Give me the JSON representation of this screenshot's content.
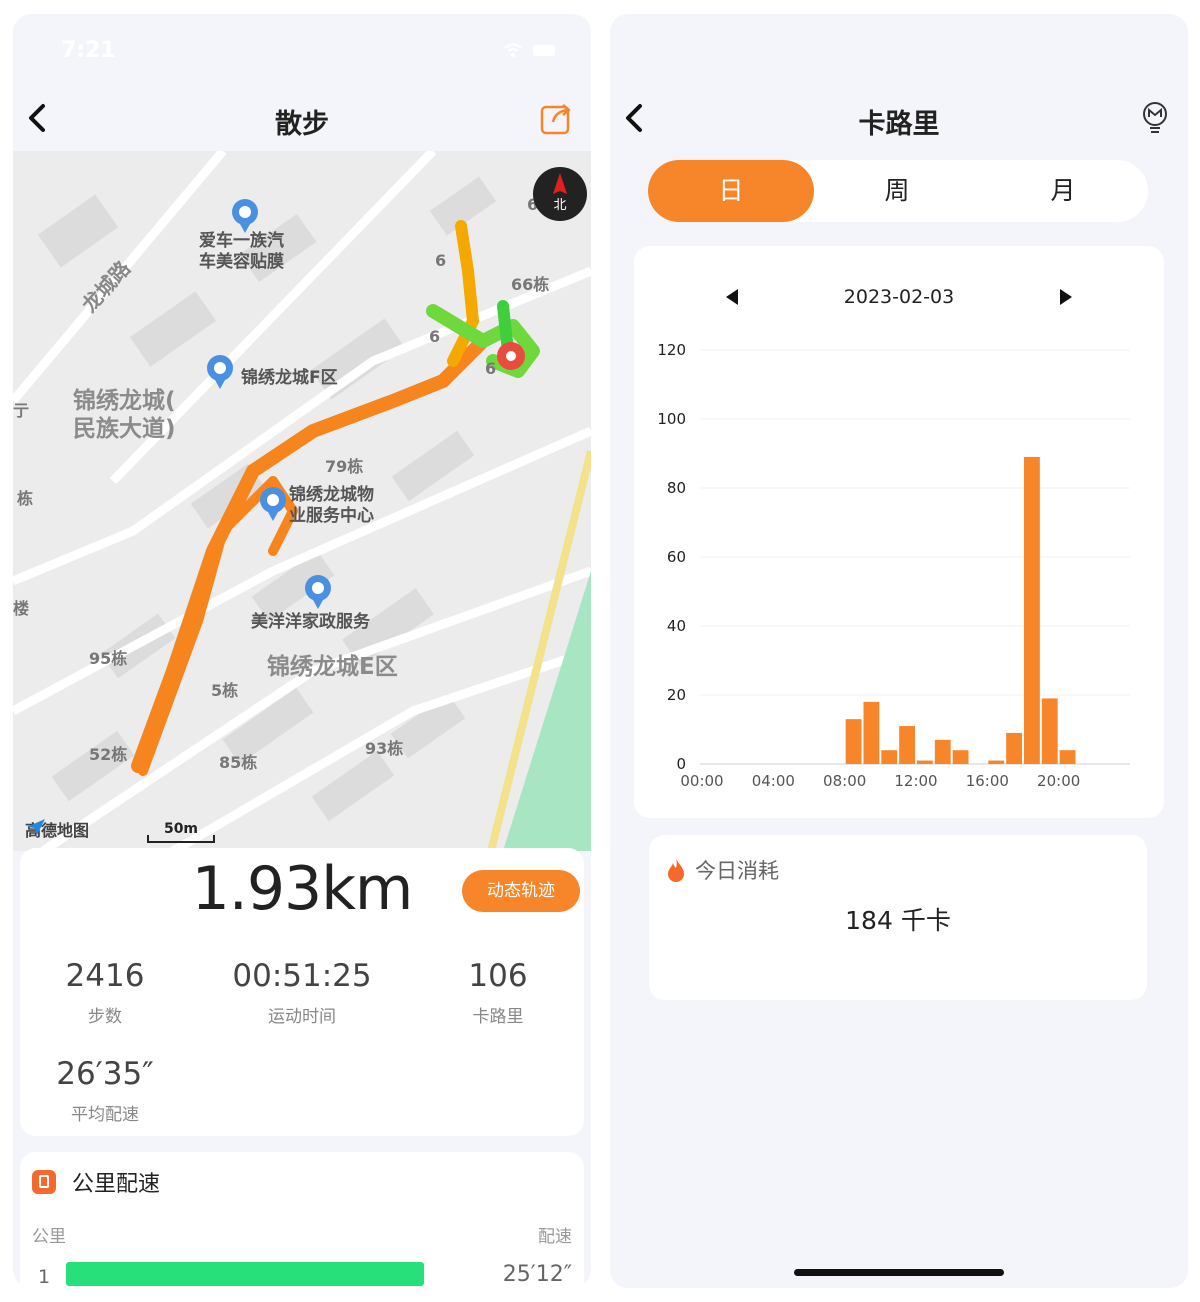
{
  "left": {
    "status_time": "7:21",
    "title": "散步",
    "map": {
      "labels": [
        "爱车一族汽\n车美容贴膜",
        "锦绣龙城F区",
        "锦绣龙城(\n民族大道)",
        "锦绣龙城物\n业服务中心",
        "美洋洋家政服务",
        "锦绣龙城E区",
        "龙城路"
      ],
      "numbers": [
        "66栋",
        "79栋",
        "95栋",
        "5栋",
        "52栋",
        "85栋",
        "93栋",
        "6",
        "6",
        "6",
        "6",
        "栋",
        "楼",
        "亍"
      ],
      "compass": "北",
      "brand": "高德地图",
      "scale": "50m"
    },
    "distance": "1.93km",
    "dynamic_button": "动态轨迹",
    "stats": [
      {
        "value": "2416",
        "label": "步数"
      },
      {
        "value": "00:51:25",
        "label": "运动时间"
      },
      {
        "value": "106",
        "label": "卡路里"
      },
      {
        "value": "26′35″",
        "label": "平均配速"
      }
    ],
    "pace": {
      "title": "公里配速",
      "col_km": "公里",
      "col_pace": "配速",
      "rows": [
        {
          "km": "1",
          "pace": "25′12″"
        }
      ]
    }
  },
  "right": {
    "title": "卡路里",
    "tabs": [
      "日",
      "周",
      "月"
    ],
    "active_tab": 0,
    "date": "2023-02-03",
    "today_label": "今日消耗",
    "today_value": "184 千卡"
  },
  "colors": {
    "accent": "#f7852a",
    "pace_bar": "#27e07a"
  },
  "chart_data": {
    "type": "bar",
    "x_ticks": [
      "00:00",
      "04:00",
      "08:00",
      "12:00",
      "16:00",
      "20:00"
    ],
    "y_ticks": [
      0,
      20,
      40,
      60,
      80,
      100,
      120
    ],
    "ylim": [
      0,
      120
    ],
    "hours": [
      8,
      9,
      10,
      11,
      12,
      13,
      14,
      16,
      17,
      18,
      19,
      20
    ],
    "values": [
      13,
      18,
      4,
      11,
      1,
      7,
      4,
      1,
      9,
      89,
      19,
      4
    ]
  }
}
